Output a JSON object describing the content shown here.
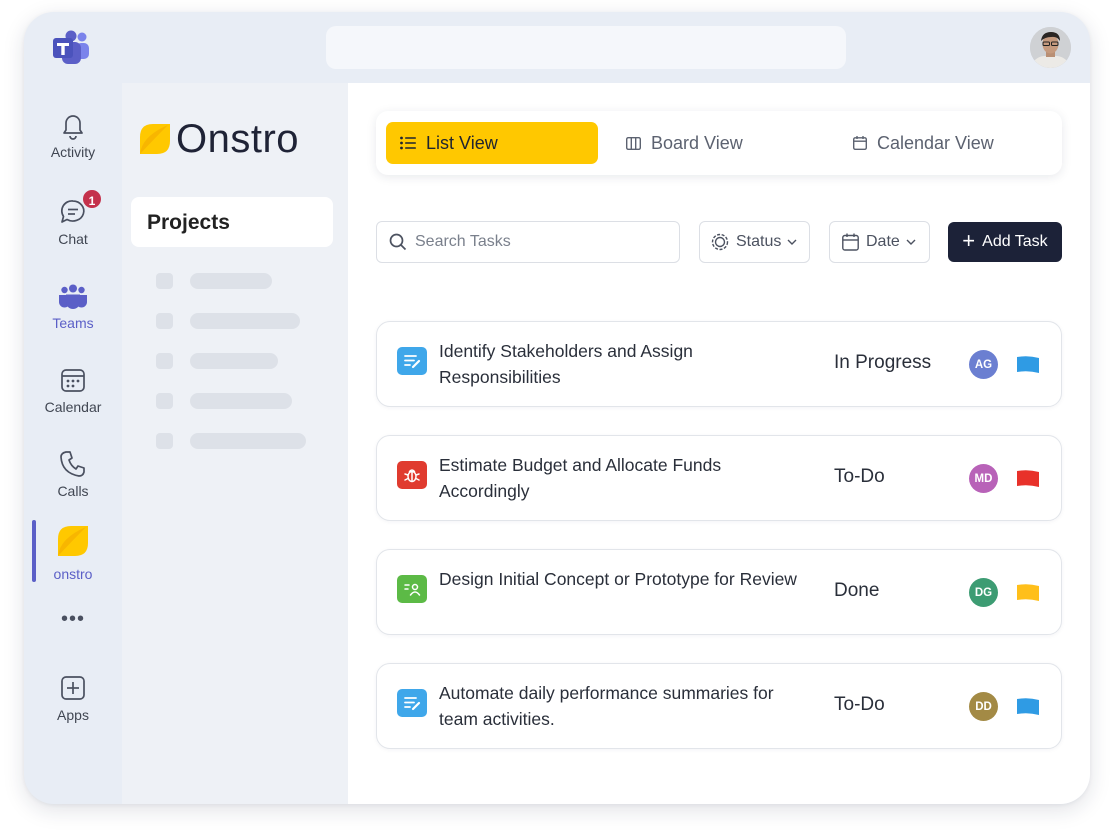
{
  "app": {
    "brand_name": "Onstro",
    "colors": {
      "accent": "#ffc800",
      "teams_purple": "#5b5fc7",
      "dark_button": "#1c2238"
    }
  },
  "rail": {
    "items": [
      {
        "label": "Activity",
        "icon": "bell-icon"
      },
      {
        "label": "Chat",
        "icon": "chat-icon",
        "badge": "1"
      },
      {
        "label": "Teams",
        "icon": "teams-icon"
      },
      {
        "label": "Calendar",
        "icon": "calendar-icon"
      },
      {
        "label": "Calls",
        "icon": "phone-icon"
      },
      {
        "label": "onstro",
        "icon": "onstro-leaf-icon"
      },
      {
        "label": "Apps",
        "icon": "plus-square-icon"
      }
    ],
    "more": "•••"
  },
  "projects": {
    "heading": "Projects"
  },
  "views": {
    "tabs": [
      {
        "label": "List View",
        "icon": "list-icon",
        "active": true
      },
      {
        "label": "Board View",
        "icon": "board-icon",
        "active": false
      },
      {
        "label": "Calendar View",
        "icon": "calendar-icon",
        "active": false
      }
    ]
  },
  "toolbar": {
    "search_placeholder": "Search Tasks",
    "status_label": "Status",
    "date_label": "Date",
    "add_task_label": "Add Task"
  },
  "tasks": [
    {
      "title": "Identify Stakeholders and Assign Responsibilities",
      "status": "In Progress",
      "assignee": "AG",
      "type_icon": "document-edit-icon",
      "icon_color": "#3fa7ea",
      "avatar_color": "#6b7fd1",
      "flag_color": "#2f9be4"
    },
    {
      "title": "Estimate Budget and Allocate Funds Accordingly",
      "status": "To-Do",
      "assignee": "MD",
      "type_icon": "bug-icon",
      "icon_color": "#e03b2f",
      "avatar_color": "#b862b8",
      "flag_color": "#e8312a"
    },
    {
      "title": "Design Initial Concept or Prototype for Review",
      "status": "Done",
      "assignee": "DG",
      "type_icon": "user-card-icon",
      "icon_color": "#5cba46",
      "avatar_color": "#3d9c73",
      "flag_color": "#ffbf1a"
    },
    {
      "title": "Automate daily performance summaries for team activities.",
      "status": "To-Do",
      "assignee": "DD",
      "type_icon": "document-edit-icon",
      "icon_color": "#3fa7ea",
      "avatar_color": "#a38a45",
      "flag_color": "#2f9be4"
    }
  ]
}
